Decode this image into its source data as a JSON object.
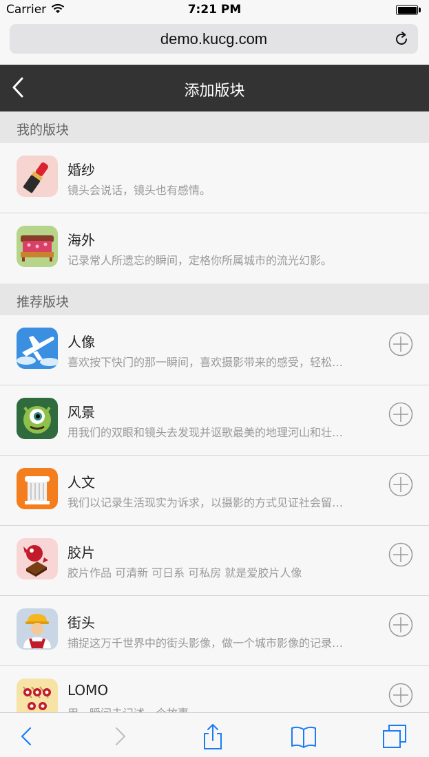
{
  "status_bar": {
    "carrier": "Carrier",
    "time": "7:21 PM"
  },
  "browser": {
    "url": "demo.kucg.com"
  },
  "header": {
    "title": "添加版块"
  },
  "my_section": {
    "title": "我的版块",
    "items": [
      {
        "title": "婚纱",
        "desc": "镜头会说话，镜头也有感情。",
        "icon": "lipstick-icon"
      },
      {
        "title": "海外",
        "desc": "记录常人所遗忘的瞬间，定格你所属城市的流光幻影。",
        "icon": "bed-icon"
      }
    ]
  },
  "recommended_section": {
    "title": "推荐版块",
    "items": [
      {
        "title": "人像",
        "desc": "喜欢按下快门的那一瞬间，喜欢摄影带来的感受，轻松…",
        "icon": "airplane-icon"
      },
      {
        "title": "风景",
        "desc": "用我们的双眼和镜头去发现并讴歌最美的地理河山和壮…",
        "icon": "monster-icon"
      },
      {
        "title": "人文",
        "desc": "我们以记录生活现实为诉求，以摄影的方式见证社会留…",
        "icon": "column-icon"
      },
      {
        "title": "胶片",
        "desc": "胶片作品 可清新 可日系 可私房 就是爱胶片人像",
        "icon": "candy-icon"
      },
      {
        "title": "街头",
        "desc": "捕捉这万千世界中的街头影像，做一个城市影像的记录…",
        "icon": "worker-icon"
      },
      {
        "title": "LOMO",
        "desc": "用一瞬间去记述一个故事",
        "icon": "meat-icon"
      }
    ]
  },
  "colors": {
    "nav_bg": "#333333",
    "ios_blue": "#1a7cf5",
    "section_bg": "#e6e6e6"
  }
}
